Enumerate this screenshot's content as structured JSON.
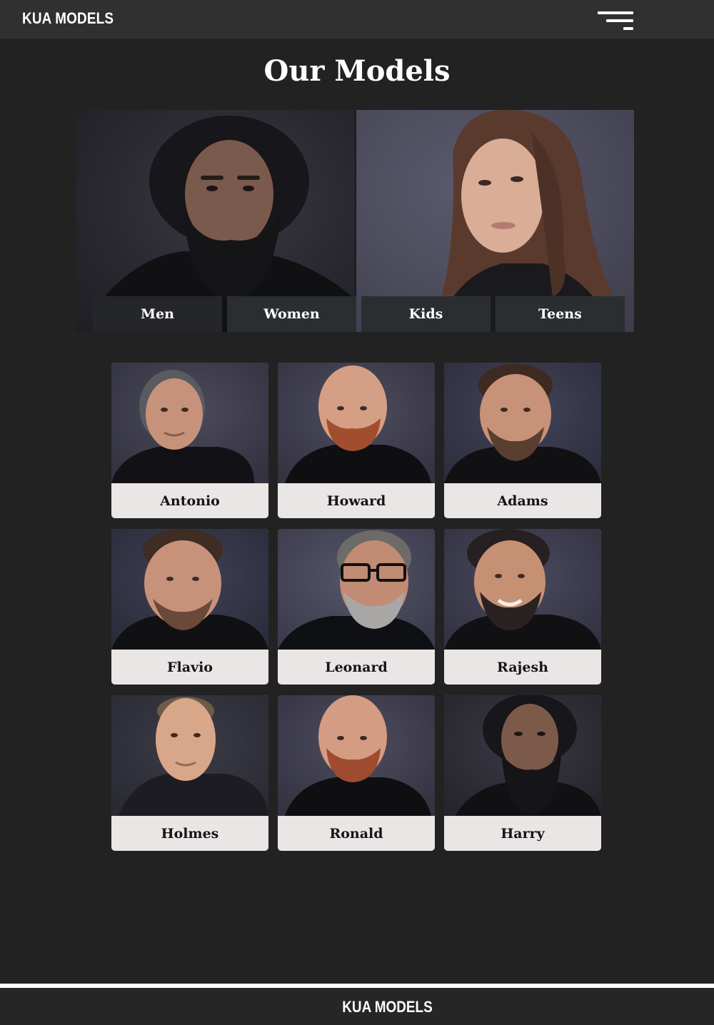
{
  "header": {
    "brand": "KUA MODELS",
    "menu_icon": "hamburger-menu-icon"
  },
  "page": {
    "title": "Our Models"
  },
  "hero": {
    "tabs": [
      {
        "label": "Men",
        "active": true
      },
      {
        "label": "Women",
        "active": false
      },
      {
        "label": "Kids",
        "active": false
      },
      {
        "label": "Teens",
        "active": false
      }
    ]
  },
  "models": [
    {
      "name": "Antonio"
    },
    {
      "name": "Howard"
    },
    {
      "name": "Adams"
    },
    {
      "name": "Flavio"
    },
    {
      "name": "Leonard"
    },
    {
      "name": "Rajesh"
    },
    {
      "name": "Holmes"
    },
    {
      "name": "Ronald"
    },
    {
      "name": "Harry"
    }
  ],
  "footer": {
    "brand": "KUA MODELS"
  },
  "colors": {
    "background": "#222222",
    "topbar": "#303030",
    "tab_bg": "#2b2e31",
    "card_label_bg": "#e9e6e5",
    "text_light": "#ffffff",
    "text_dark": "#151515"
  }
}
